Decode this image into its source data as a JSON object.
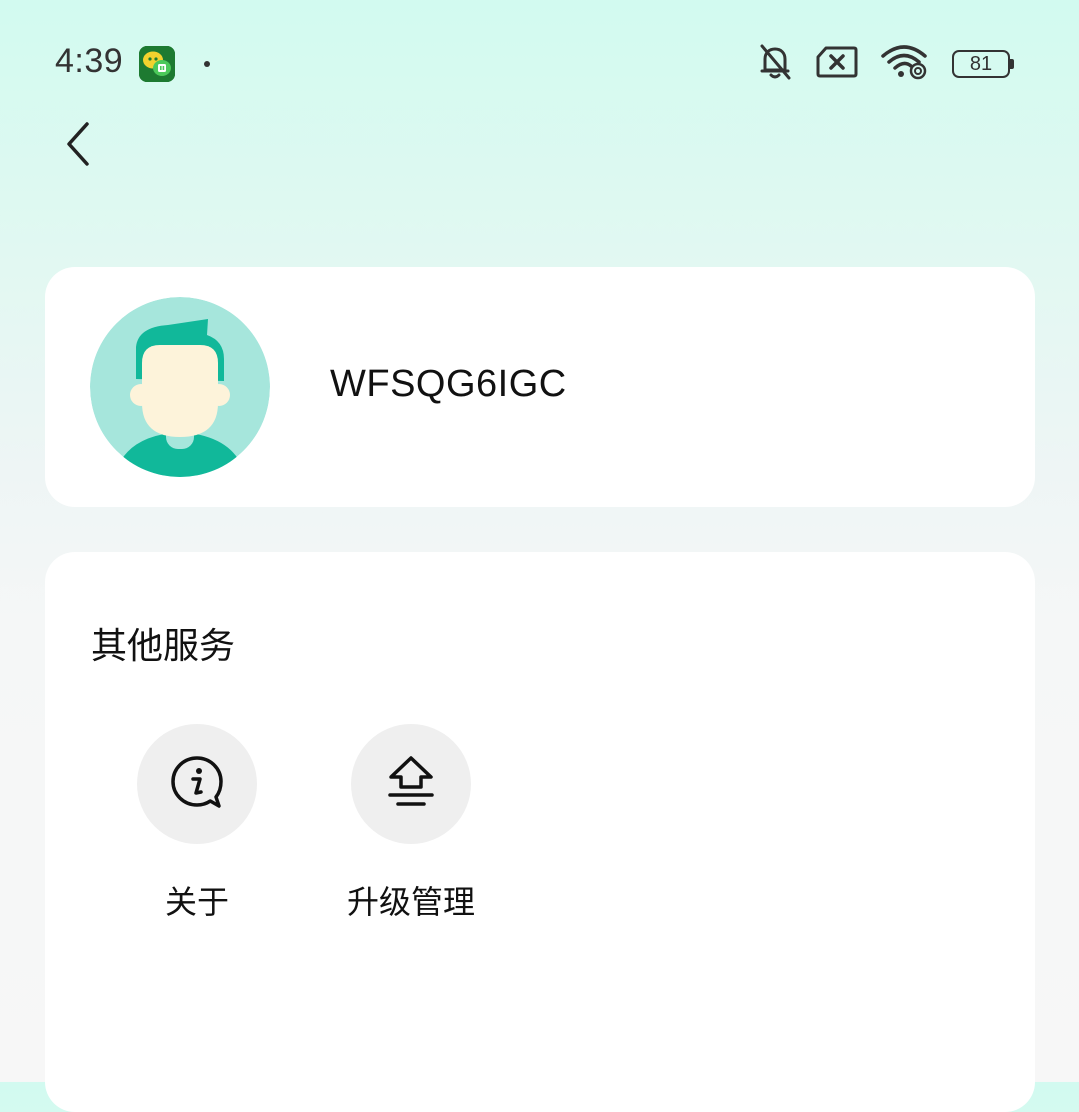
{
  "status_bar": {
    "time": "4:39",
    "notification_icon": "wechat-app-icon",
    "battery_level": "81",
    "icons": [
      "bell-muted-icon",
      "sim-disabled-icon",
      "wifi-icon"
    ]
  },
  "header": {
    "back_icon": "chevron-left-icon"
  },
  "profile": {
    "username": "WFSQG6IGC",
    "avatar_icon": "user-avatar-icon"
  },
  "services": {
    "title": "其他服务",
    "items": [
      {
        "label": "关于",
        "icon": "info-bubble-icon"
      },
      {
        "label": "升级管理",
        "icon": "upgrade-arrow-icon"
      }
    ]
  },
  "colors": {
    "accent": "#11b89a",
    "avatar_bg": "#a6e6dc",
    "face": "#fdf3da",
    "icon_circle": "#efefef"
  }
}
